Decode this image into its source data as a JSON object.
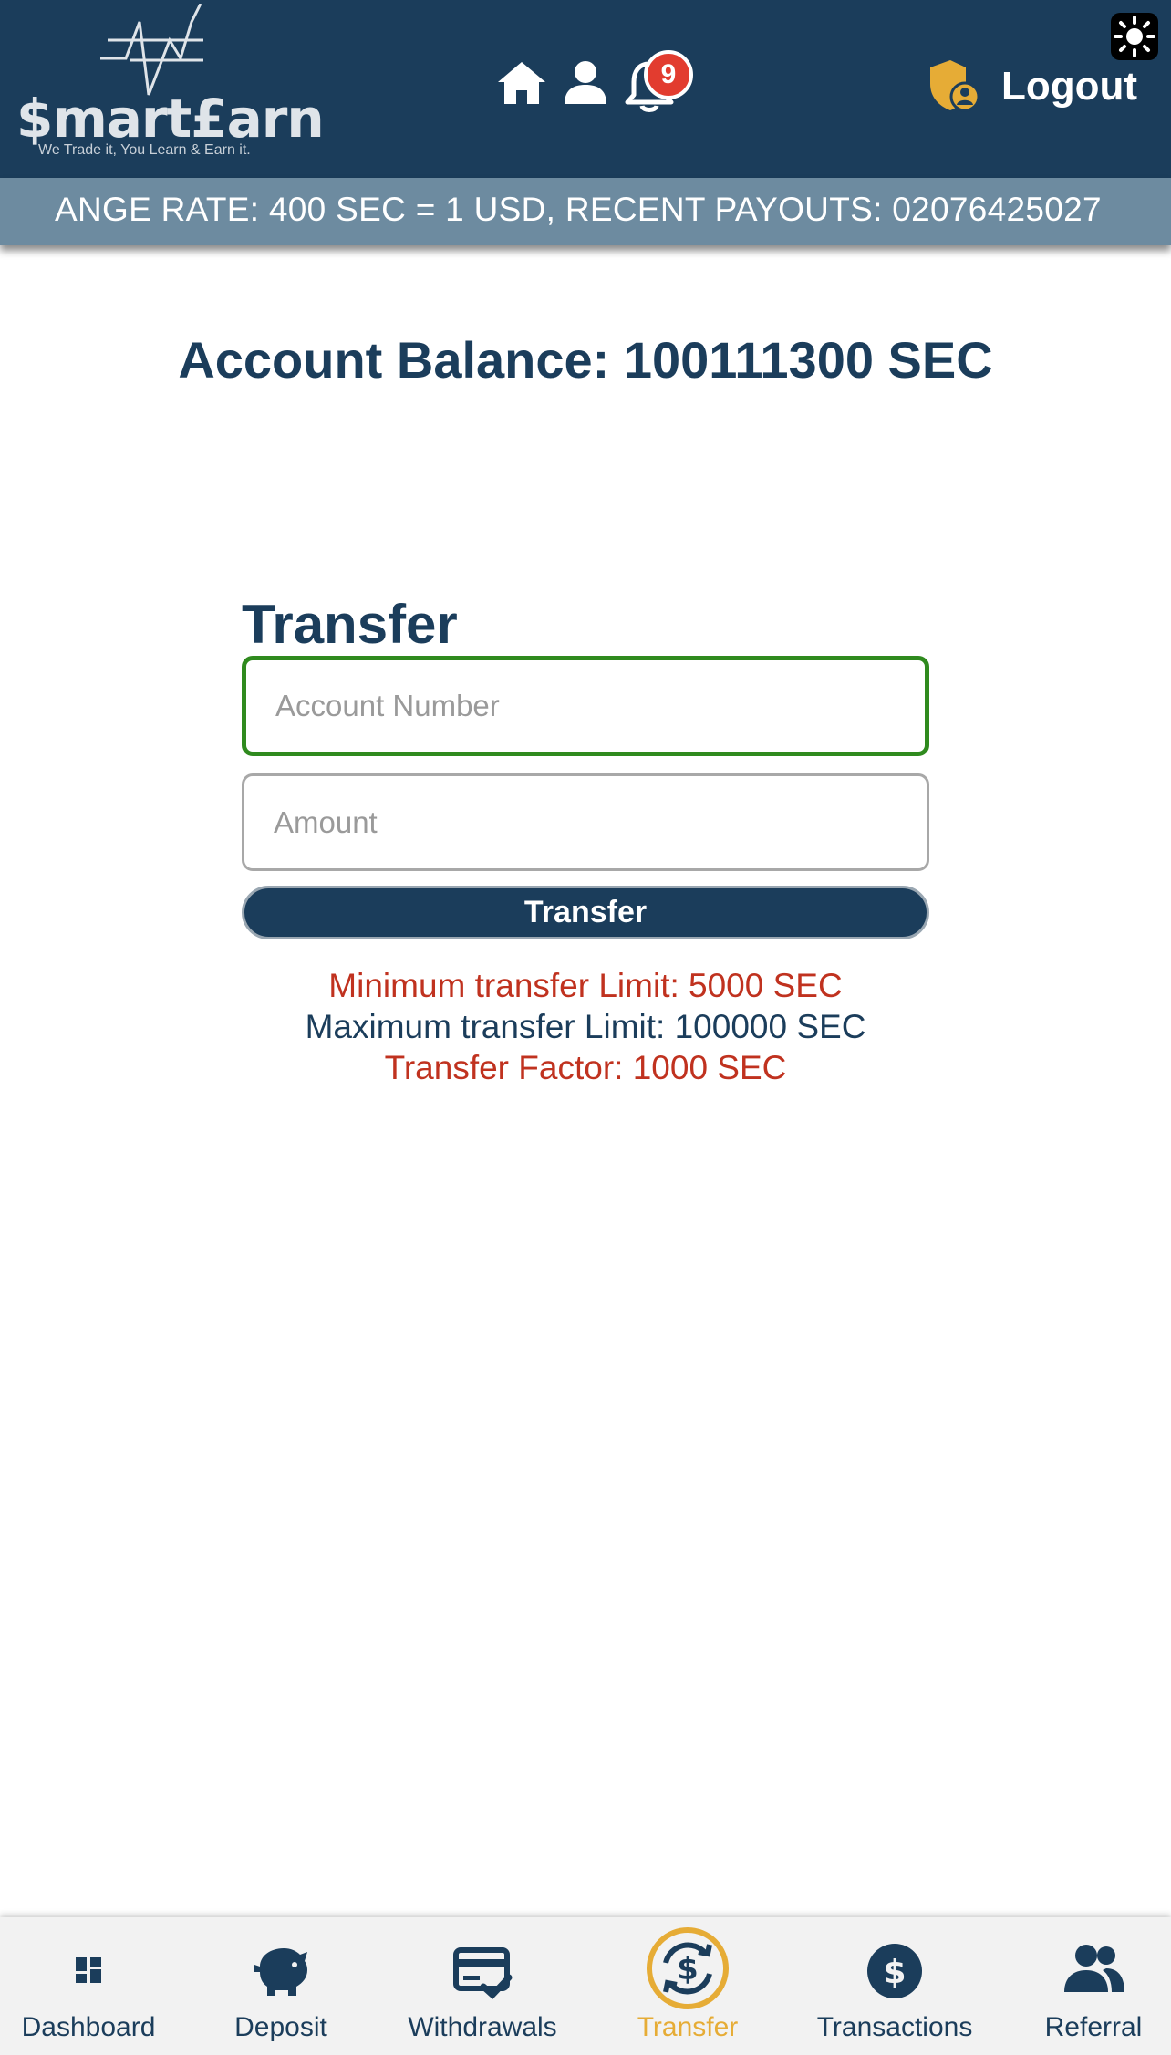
{
  "header": {
    "logo_text": "$mart£arn",
    "logo_tagline": "We Trade it, You Learn & Earn it.",
    "notification_count": "9",
    "logout_label": "Logout",
    "icons": [
      "home-icon",
      "user-icon",
      "bell-icon",
      "shield-user-icon",
      "sun-icon"
    ]
  },
  "ticker": {
    "text": "ANGE RATE: 400 SEC = 1 USD, RECENT PAYOUTS: 02076425027"
  },
  "balance": {
    "text": "Account Balance: 100111300 SEC"
  },
  "transfer_form": {
    "title": "Transfer",
    "account_placeholder": "Account Number",
    "account_value": "",
    "amount_placeholder": "Amount",
    "amount_value": "",
    "submit_label": "Transfer",
    "min_limit": "Minimum transfer Limit: 5000 SEC",
    "max_limit": "Maximum transfer Limit: 100000 SEC",
    "factor": "Transfer Factor: 1000 SEC"
  },
  "bottom_nav": {
    "items": [
      {
        "label": "Dashboard",
        "icon": "dashboard-icon"
      },
      {
        "label": "Deposit",
        "icon": "piggy-bank-icon"
      },
      {
        "label": "Withdrawals",
        "icon": "card-check-icon"
      },
      {
        "label": "Transfer",
        "icon": "transfer-icon",
        "active": true
      },
      {
        "label": "Transactions",
        "icon": "dollar-icon"
      },
      {
        "label": "Referral",
        "icon": "group-icon"
      }
    ]
  },
  "colors": {
    "primary": "#1b3d5b",
    "ticker": "#6d8ba0",
    "accent": "#e6ac36",
    "badge": "#e23c2f",
    "focus": "#2f8a1e",
    "warning_text": "#c0321f"
  }
}
